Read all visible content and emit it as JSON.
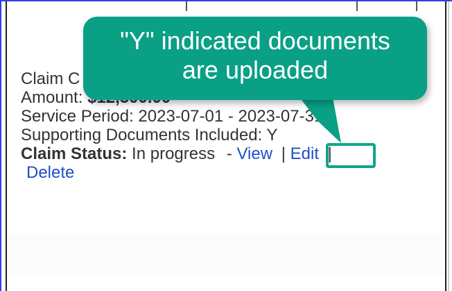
{
  "callout": {
    "line1": "\"Y\" indicated documents",
    "line2": "are uploaded"
  },
  "claim": {
    "title_fragment": "Claim C",
    "amount_label": "Amount:",
    "amount_value": "$12,500.00",
    "service_period_label": "Service Period:",
    "service_period_value": "2023-07-01 - 2023-07-31",
    "supporting_label": "Supporting Documents Included:",
    "supporting_value": "Y",
    "status_label": "Claim Status:",
    "status_value": "In progress",
    "dash": "-",
    "view_link": "View",
    "sep": "|",
    "edit_link": "Edit",
    "delete_link": "Delete"
  },
  "colors": {
    "callout_bg": "#0aa086",
    "highlight": "#10a58b",
    "link": "#1d4fc8",
    "left_border": "#2a41e8"
  }
}
